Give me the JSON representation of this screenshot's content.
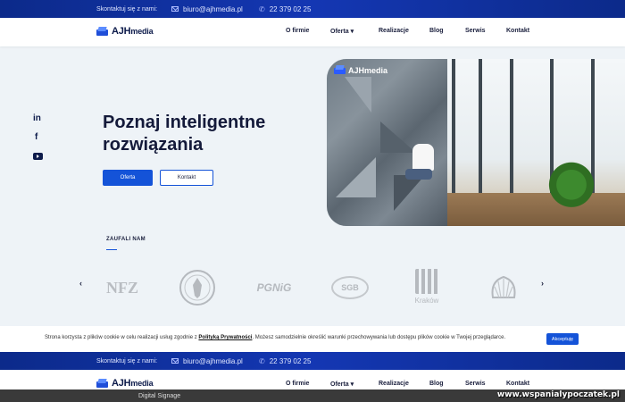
{
  "topbar": {
    "contact_label": "Skontaktuj się z nami:",
    "email": "biuro@ajhmedia.pl",
    "phone": "22 379 02 25"
  },
  "brand": {
    "name_bold": "AJH",
    "name_rest": "media"
  },
  "nav": {
    "items": [
      "O firmie",
      "Oferta",
      "Realizacje",
      "Blog",
      "Serwis",
      "Kontakt"
    ],
    "dropdown_item": "Oferta"
  },
  "social": [
    "linkedin-icon",
    "facebook-icon",
    "youtube-icon"
  ],
  "hero": {
    "title": "Poznaj inteligentne rozwiązania",
    "primary_button": "Oferta",
    "secondary_button": "Kontakt",
    "image_logo_bold": "AJH",
    "image_logo_rest": "media"
  },
  "trusted": {
    "heading": "ZAUFALI NAM",
    "partners": [
      "NFZ",
      "Godło RP",
      "PGNiG",
      "SGB",
      "Kraków",
      "Shell"
    ]
  },
  "cookie": {
    "text_before": "Strona korzysta z plików cookie w celu realizacji usług zgodnie z ",
    "link": "Polityką Prywatności",
    "text_after": ". Możesz samodzielnie określić warunki przechowywania lub dostępu plików cookie w Twojej przeglądarce.",
    "accept": "Akceptuję"
  },
  "next_section": {
    "label": "Digital Signage"
  },
  "watermark": "www.wspanialypoczatek.pl",
  "colors": {
    "primary": "#1453d8",
    "topbar": "#1437b3",
    "text": "#141a3a"
  }
}
